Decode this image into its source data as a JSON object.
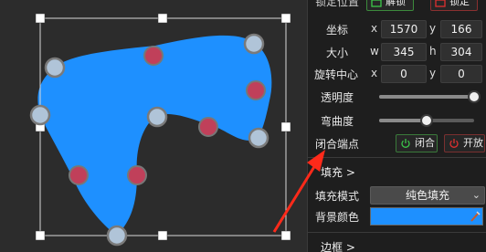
{
  "panel": {
    "top_partial": {
      "label": "锁定位置",
      "unlock_button": "解锁",
      "lock_button": "锁定"
    },
    "position": {
      "label": "坐标",
      "x_axis": "x",
      "y_axis": "y",
      "x": "1570",
      "y": "166"
    },
    "size": {
      "label": "大小",
      "w_axis": "w",
      "h_axis": "h",
      "w": "345",
      "h": "304"
    },
    "pivot": {
      "label": "旋转中心",
      "x_axis": "x",
      "y_axis": "y",
      "x": "0",
      "y": "0"
    },
    "opacity": {
      "label": "透明度",
      "value": 1.0
    },
    "curvature": {
      "label": "弯曲度",
      "value": 0.5
    },
    "closed_endpoints": {
      "label": "闭合端点",
      "close_button": "闭合",
      "open_button": "开放"
    },
    "fill_section": {
      "label": "填充 >"
    },
    "fill_mode": {
      "label": "填充模式",
      "value": "纯色填充"
    },
    "bg_color": {
      "label": "背景颜色",
      "color": "#1e90ff"
    },
    "border_section": {
      "label": "边框 >"
    }
  },
  "colors": {
    "shape_fill": "#1e90ff",
    "control_point": "#b0c4d8",
    "mid_point": "#c0405a",
    "annotation_arrow": "#ff2a1a",
    "power_green": "#3cc84a",
    "power_red": "#e03030"
  }
}
